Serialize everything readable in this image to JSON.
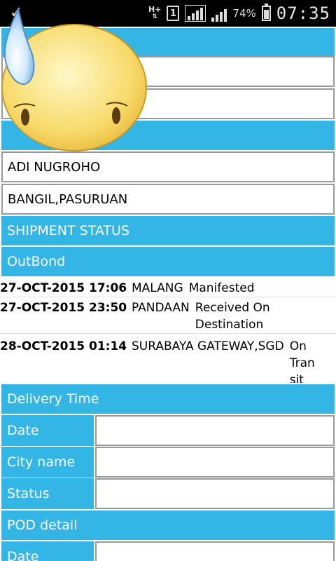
{
  "status_bar": {
    "network_type": "H+",
    "sim_slot": "1",
    "battery_percent": "74%",
    "battery_level": 0.74,
    "time": "07:35",
    "notification_icon": "check-icon"
  },
  "consignee": {
    "name": "ADI NUGROHO",
    "address": "BANGIL,PASURUAN"
  },
  "shipment": {
    "header": "SHIPMENT STATUS",
    "direction": "OutBond",
    "rows": [
      {
        "datetime": "27-OCT-2015 17:06",
        "city": "MALANG",
        "status": "Manifested"
      },
      {
        "datetime": "27-OCT-2015 23:50",
        "city": "PANDAAN",
        "status_line1": "Received On",
        "status_line2": "Destination"
      },
      {
        "datetime": "28-OCT-2015 01:14",
        "city": "SURABAYA GATEWAY,SGD",
        "status_line1": "On",
        "status_line2": "Tran",
        "status_line3": "sit"
      }
    ]
  },
  "delivery": {
    "header": "Delivery Time",
    "date_label": "Date",
    "city_label": "City name",
    "status_label": "Status"
  },
  "pod": {
    "header": "POD detail",
    "date_label": "Date"
  },
  "colors": {
    "accent": "#33b5e5",
    "statusbar": "#000000"
  }
}
